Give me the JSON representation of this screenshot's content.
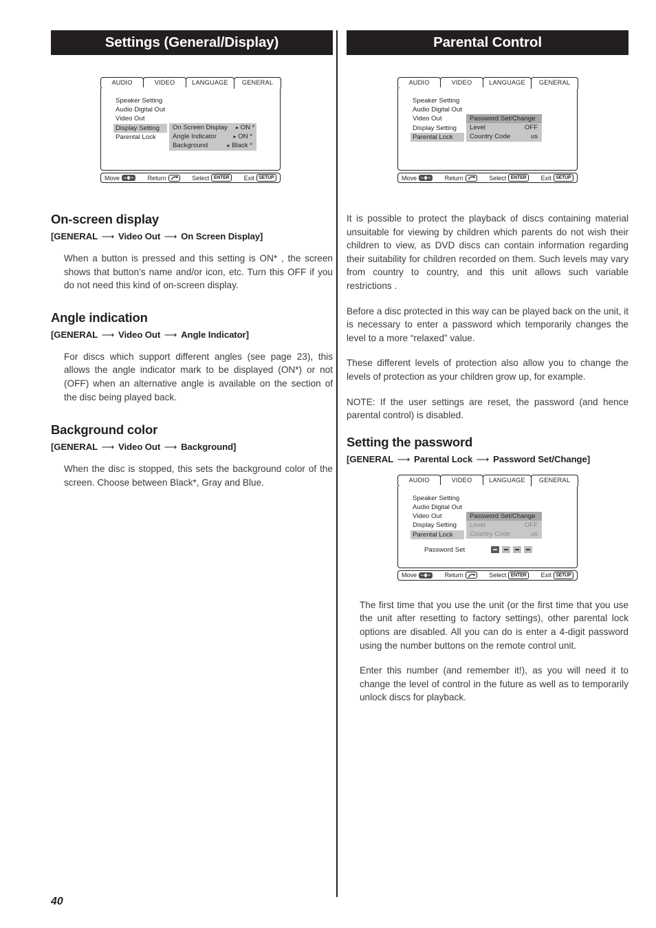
{
  "page": {
    "number": "40"
  },
  "left_column": {
    "header": "Settings (General/Display)",
    "osd": {
      "tabs": [
        "AUDIO",
        "VIDEO",
        "LANGUAGE",
        "GENERAL"
      ],
      "active_tab": "GENERAL",
      "menu_items": [
        "Speaker Setting",
        "Audio Digital Out",
        "Video Out",
        "Display Setting",
        "Parental Lock"
      ],
      "selected_menu_item": "Display Setting",
      "submenu": [
        {
          "label": "On Screen Display",
          "marker": "▸",
          "value": "ON *"
        },
        {
          "label": "Angle Indicator",
          "marker": "▸",
          "value": "ON *"
        },
        {
          "label": "Background",
          "marker": "▸",
          "value": "Black *"
        }
      ],
      "footer": {
        "move": "Move",
        "return": "Return",
        "select": "Select",
        "select_key": "ENTER",
        "exit": "Exit",
        "exit_key": "SETUP"
      }
    },
    "sections": [
      {
        "title": "On-screen display",
        "path_prefix": "[GENERAL",
        "path_mid": "Video Out",
        "path_suffix": "On Screen Display]",
        "body": "When a button is pressed and this setting is ON* , the screen shows that button’s name and/or icon, etc. Turn this OFF if you do not need this kind of on-screen display."
      },
      {
        "title": "Angle indication",
        "path_prefix": "[GENERAL",
        "path_mid": "Video Out",
        "path_suffix": "Angle Indicator]",
        "body": "For discs which support different angles (see page 23), this allows the angle indicator mark to be displayed (ON*) or not (OFF) when an alternative angle is available on the section of the disc being played back."
      },
      {
        "title": "Background color",
        "path_prefix": "[GENERAL",
        "path_mid": "Video Out",
        "path_suffix": "Background]",
        "body": "When the disc is stopped, this sets the background color of the screen. Choose between Black*, Gray and Blue."
      }
    ]
  },
  "right_column": {
    "header": "Parental Control",
    "osd_top": {
      "tabs": [
        "AUDIO",
        "VIDEO",
        "LANGUAGE",
        "GENERAL"
      ],
      "active_tab": "GENERAL",
      "menu_items": [
        "Speaker Setting",
        "Audio Digital Out",
        "Video Out",
        "Display Setting",
        "Parental Lock"
      ],
      "selected_menu_item": "Parental Lock",
      "submenu": [
        {
          "label": "Password Set/Change",
          "value": ""
        },
        {
          "label": "Level",
          "value": "OFF"
        },
        {
          "label": "Country Code",
          "value": "us"
        }
      ],
      "footer": {
        "move": "Move",
        "return": "Return",
        "select": "Select",
        "select_key": "ENTER",
        "exit": "Exit",
        "exit_key": "SETUP"
      }
    },
    "paragraphs": [
      "It is possible to protect the playback of discs containing material unsuitable for viewing by children which parents do not wish their children to view, as DVD discs can contain information regarding their suitability for children recorded on them. Such levels may vary from country to country, and this unit allows such variable restrictions .",
      "Before a disc protected in this way can be played back on the unit, it is necessary to enter a password which temporarily changes the level to a more “relaxed” value.",
      "These different levels of protection also allow you to change the levels of protection as your children grow up, for example.",
      "NOTE: If the user settings are reset, the password (and hence parental control) is disabled."
    ],
    "password_section": {
      "title": "Setting the password",
      "path_prefix": "[GENERAL",
      "path_mid": "Parental Lock",
      "path_suffix": "Password Set/Change]"
    },
    "osd_bottom": {
      "tabs": [
        "AUDIO",
        "VIDEO",
        "LANGUAGE",
        "GENERAL"
      ],
      "active_tab": "GENERAL",
      "menu_items": [
        "Speaker Setting",
        "Audio Digital Out",
        "Video Out",
        "Display Setting",
        "Parental Lock"
      ],
      "selected_menu_item": "Parental Lock",
      "submenu": [
        {
          "label": "Password Set/Change",
          "value": ""
        },
        {
          "label": "Level",
          "value": "OFF"
        },
        {
          "label": "Country Code",
          "value": "us"
        }
      ],
      "password_set_label": "Password Set",
      "password_digits": [
        "-",
        "-",
        "-",
        "-"
      ],
      "footer": {
        "move": "Move",
        "return": "Return",
        "select": "Select",
        "select_key": "ENTER",
        "exit": "Exit",
        "exit_key": "SETUP"
      }
    },
    "paragraphs_after": [
      "The first time that you use the unit (or the first time that you use the unit after resetting to factory settings), other parental lock options are disabled. All you can do is enter a 4-digit password using the number buttons on the remote control unit.",
      "Enter this number (and remember it!), as you will need it to change the level of control in the future as well as to temporarily unlock discs for playback."
    ]
  },
  "icons": {
    "move": "dpad-icon",
    "return": "return-arrow-icon"
  }
}
